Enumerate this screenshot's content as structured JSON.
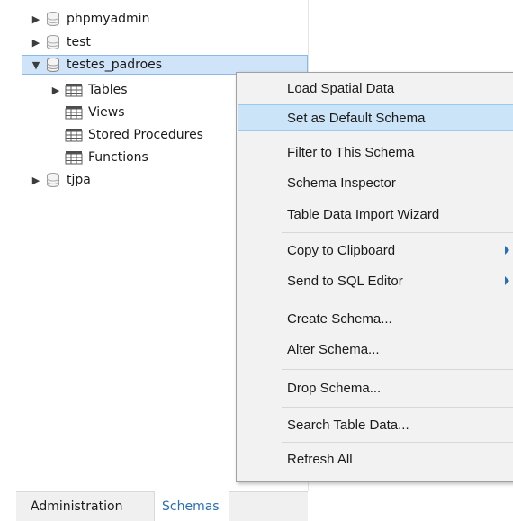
{
  "navigator": {
    "items": [
      {
        "label": "phpmyadmin",
        "arrow": "▶",
        "icon": "database-icon"
      },
      {
        "label": "test",
        "arrow": "▶",
        "icon": "database-icon"
      },
      {
        "label": "testes_padroes",
        "arrow": "▼",
        "icon": "database-icon",
        "selected": true
      },
      {
        "label": "Tables",
        "arrow": "▶",
        "icon": "table-folder-icon"
      },
      {
        "label": "Views",
        "arrow": "",
        "icon": "table-folder-icon"
      },
      {
        "label": "Stored Procedures",
        "arrow": "",
        "icon": "table-folder-icon"
      },
      {
        "label": "Functions",
        "arrow": "",
        "icon": "table-folder-icon"
      },
      {
        "label": "tjpa",
        "arrow": "▶",
        "icon": "database-icon"
      }
    ]
  },
  "tabs": {
    "administration": "Administration",
    "schemas": "Schemas"
  },
  "context_menu": {
    "items": [
      {
        "label": "Load Spatial Data"
      },
      {
        "label": "Set as Default Schema",
        "hover": true
      },
      {
        "label": "Filter to This Schema"
      },
      {
        "label": "Schema Inspector"
      },
      {
        "label": "Table Data Import Wizard"
      },
      {
        "label": "Copy to Clipboard",
        "submenu": true
      },
      {
        "label": "Send to SQL Editor",
        "submenu": true
      },
      {
        "label": "Create Schema..."
      },
      {
        "label": "Alter Schema..."
      },
      {
        "label": "Drop Schema..."
      },
      {
        "label": "Search Table Data..."
      },
      {
        "label": "Refresh All"
      }
    ]
  },
  "colors": {
    "selection_bg": "#cfe3f9",
    "menu_hover_bg": "#cce4f7",
    "accent_blue": "#2a6fb5",
    "menu_bg": "#f2f2f2"
  }
}
